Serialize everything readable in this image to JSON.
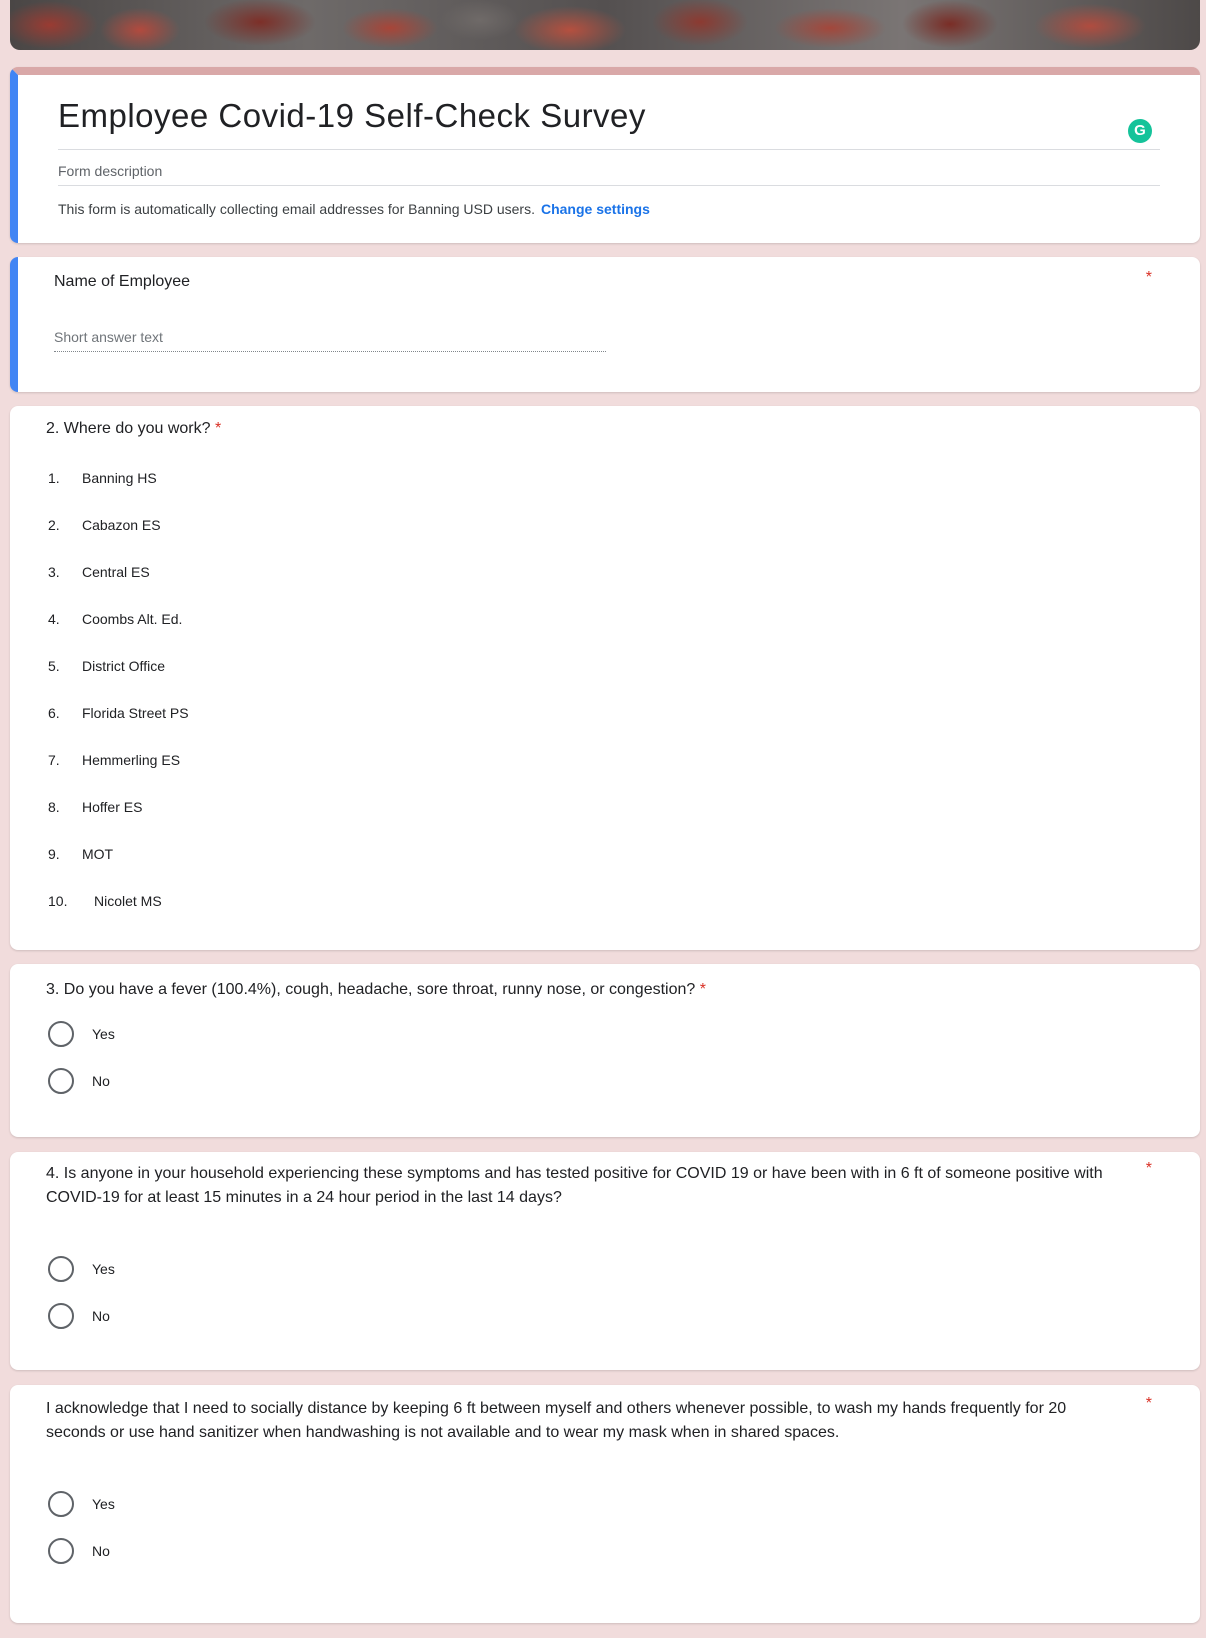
{
  "form": {
    "title": "Employee Covid-19 Self-Check Survey",
    "description_placeholder": "Form description",
    "email_note": "This form is automatically collecting email addresses for Banning USD users.",
    "change_settings_label": "Change settings",
    "badge_letter": "G"
  },
  "q1": {
    "title": "Name of Employee",
    "required_mark": "*",
    "placeholder": "Short answer text"
  },
  "q2": {
    "title": "2. Where do you work?",
    "required_mark": "*",
    "options": [
      {
        "num": "1.",
        "label": "Banning HS"
      },
      {
        "num": "2.",
        "label": "Cabazon ES"
      },
      {
        "num": "3.",
        "label": "Central ES"
      },
      {
        "num": "4.",
        "label": "Coombs Alt. Ed."
      },
      {
        "num": "5.",
        "label": "District Office"
      },
      {
        "num": "6.",
        "label": "Florida Street PS"
      },
      {
        "num": "7.",
        "label": "Hemmerling ES"
      },
      {
        "num": "8.",
        "label": "Hoffer ES"
      },
      {
        "num": "9.",
        "label": "MOT"
      },
      {
        "num": "10.",
        "label": "Nicolet MS"
      }
    ]
  },
  "q3": {
    "title": "3. Do you have a fever (100.4%), cough, headache, sore throat, runny nose, or congestion?",
    "required_mark": "*",
    "yes": "Yes",
    "no": "No"
  },
  "q4": {
    "title": "4. Is anyone in your household experiencing these symptoms and has tested positive for COVID 19 or have been with in 6 ft of someone positive with  COVID-19 for at least 15 minutes in a 24 hour period in the last 14 days?",
    "required_mark": "*",
    "yes": "Yes",
    "no": "No"
  },
  "q5": {
    "title": "I acknowledge that  I need to socially distance by keeping 6 ft between myself and others whenever possible, to wash my hands frequently for 20 seconds or use hand sanitizer when handwashing is not available and to wear my mask when in shared spaces.",
    "required_mark": "*",
    "yes": "Yes",
    "no": "No"
  },
  "colors": {
    "accent": "#4285f4",
    "required": "#d93025",
    "link": "#1a73e8",
    "page_background": "#f1dcdc"
  }
}
